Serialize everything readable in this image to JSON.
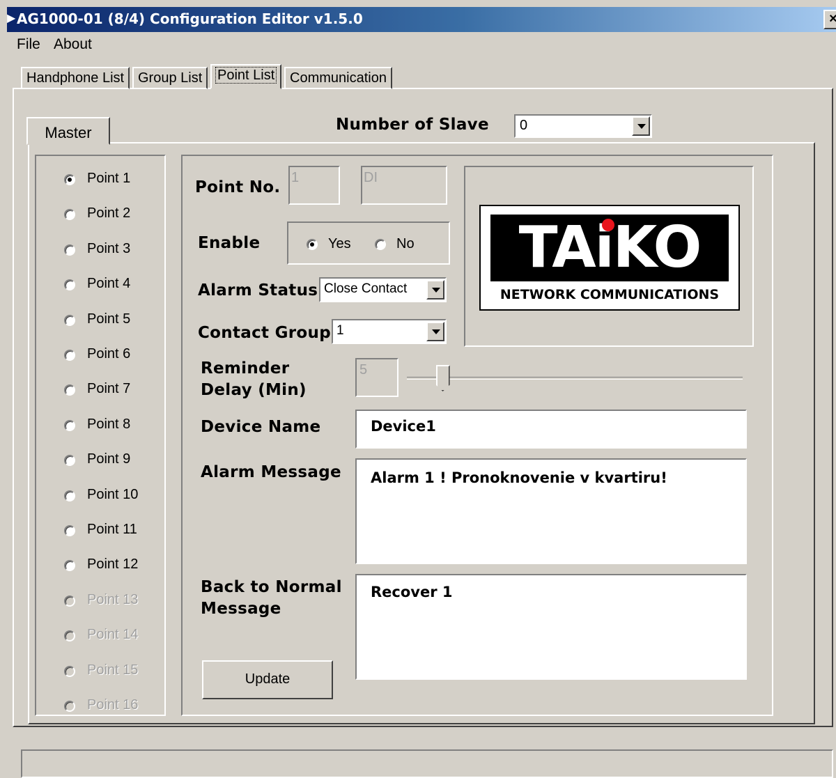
{
  "window": {
    "title": "AG1000-01 (8/4) Configuration Editor v1.5.0",
    "close_icon": "close-icon",
    "close_glyph": "×"
  },
  "menu": {
    "file": "File",
    "about": "About"
  },
  "tabs": [
    "Handphone List",
    "Group List",
    "Point List",
    "Communication"
  ],
  "active_tab": "Point List",
  "master_tab": "Master",
  "number_of_slave": {
    "label": "Number of Slave",
    "value": "0"
  },
  "points": [
    {
      "label": "Point 1",
      "selected": true,
      "enabled": true
    },
    {
      "label": "Point 2",
      "selected": false,
      "enabled": true
    },
    {
      "label": "Point 3",
      "selected": false,
      "enabled": true
    },
    {
      "label": "Point 4",
      "selected": false,
      "enabled": true
    },
    {
      "label": "Point 5",
      "selected": false,
      "enabled": true
    },
    {
      "label": "Point 6",
      "selected": false,
      "enabled": true
    },
    {
      "label": "Point 7",
      "selected": false,
      "enabled": true
    },
    {
      "label": "Point 8",
      "selected": false,
      "enabled": true
    },
    {
      "label": "Point 9",
      "selected": false,
      "enabled": true
    },
    {
      "label": "Point 10",
      "selected": false,
      "enabled": true
    },
    {
      "label": "Point 11",
      "selected": false,
      "enabled": true
    },
    {
      "label": "Point 12",
      "selected": false,
      "enabled": true
    },
    {
      "label": "Point 13",
      "selected": false,
      "enabled": false
    },
    {
      "label": "Point 14",
      "selected": false,
      "enabled": false
    },
    {
      "label": "Point 15",
      "selected": false,
      "enabled": false
    },
    {
      "label": "Point 16",
      "selected": false,
      "enabled": false
    }
  ],
  "form": {
    "point_no_label": "Point No.",
    "point_no_value": "1",
    "point_type_value": "DI",
    "enable_label": "Enable",
    "enable_yes": "Yes",
    "enable_no": "No",
    "enable_selected": "Yes",
    "alarm_status_label": "Alarm Status",
    "alarm_status_value": "Close Contact",
    "contact_group_label": "Contact Group",
    "contact_group_value": "1",
    "reminder_label_1": "Reminder",
    "reminder_label_2": "Delay (Min)",
    "reminder_value": "5",
    "reminder_slider_fraction": 0.09,
    "device_name_label": "Device Name",
    "device_name_value": "Device1",
    "alarm_message_label": "Alarm Message",
    "alarm_message_value": "Alarm 1 ! Pronoknovenie v kvartiru!",
    "back_normal_label_1": "Back to Normal",
    "back_normal_label_2": "Message",
    "back_normal_value": "Recover 1",
    "update_button": "Update"
  },
  "logo": {
    "brand": "TAiKO",
    "tagline": "NETWORK COMMUNICATIONS",
    "dot_color": "#e8141c"
  }
}
